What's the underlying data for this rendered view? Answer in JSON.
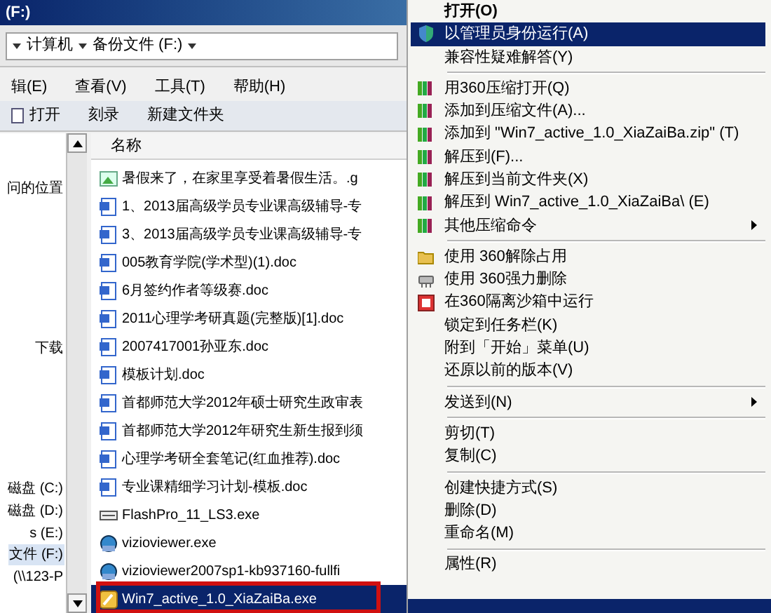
{
  "window": {
    "title": "(F:)"
  },
  "address_bar": {
    "crumbs": [
      "计算机",
      "备份文件 (F:)"
    ]
  },
  "menu_bar": [
    "辑(E)",
    "查看(V)",
    "工具(T)",
    "帮助(H)"
  ],
  "toolbar": [
    "打开",
    "刻录",
    "新建文件夹"
  ],
  "nav_pane": {
    "items": [
      {
        "label": "问的位置",
        "selected": false
      },
      {
        "label": "下载",
        "selected": false
      },
      {
        "label": "磁盘 (C:)",
        "selected": false
      },
      {
        "label": "磁盘 (D:)",
        "selected": false
      },
      {
        "label": "s (E:)",
        "selected": false
      },
      {
        "label": "文件 (F:)",
        "selected": true
      },
      {
        "label": "(\\\\123-P",
        "selected": false
      }
    ]
  },
  "file_list": {
    "columns": [
      "名称"
    ],
    "rows": [
      {
        "name": "暑假来了，在家里享受着暑假生活。.g",
        "kind": "image",
        "selected": false
      },
      {
        "name": "1、2013届高级学员专业课高级辅导-专",
        "kind": "doc",
        "selected": false
      },
      {
        "name": "3、2013届高级学员专业课高级辅导-专",
        "kind": "doc",
        "selected": false
      },
      {
        "name": "005教育学院(学术型)(1).doc",
        "kind": "doc",
        "selected": false
      },
      {
        "name": "6月签约作者等级赛.doc",
        "kind": "doc",
        "selected": false
      },
      {
        "name": "2011心理学考研真题(完整版)[1].doc",
        "kind": "doc",
        "selected": false
      },
      {
        "name": "2007417001孙亚东.doc",
        "kind": "doc",
        "selected": false
      },
      {
        "name": "模板计划.doc",
        "kind": "doc",
        "selected": false
      },
      {
        "name": "首都师范大学2012年硕士研究生政审表",
        "kind": "doc",
        "selected": false
      },
      {
        "name": "首都师范大学2012年研究生新生报到须",
        "kind": "doc",
        "selected": false
      },
      {
        "name": "心理学考研全套笔记(红血推荐).doc",
        "kind": "doc",
        "selected": false
      },
      {
        "name": "专业课精细学习计划-模板.doc",
        "kind": "doc",
        "selected": false
      },
      {
        "name": "FlashPro_11_LS3.exe",
        "kind": "exe",
        "selected": false
      },
      {
        "name": "vizioviewer.exe",
        "kind": "setup",
        "selected": false
      },
      {
        "name": "vizioviewer2007sp1-kb937160-fullfi",
        "kind": "setup",
        "selected": false
      },
      {
        "name": "Win7_active_1.0_XiaZaiBa.exe",
        "kind": "app",
        "selected": true
      }
    ]
  },
  "context_menu": {
    "items": [
      {
        "kind": "item",
        "label": "打开(O)",
        "bold": true,
        "selected": false
      },
      {
        "kind": "item",
        "label": "以管理员身份运行(A)",
        "selected": true
      },
      {
        "kind": "item",
        "label": "兼容性疑难解答(Y)",
        "selected": false
      },
      {
        "kind": "separator"
      },
      {
        "kind": "item",
        "label": "用360压缩打开(Q)",
        "selected": false
      },
      {
        "kind": "item",
        "label": "添加到压缩文件(A)...",
        "selected": false
      },
      {
        "kind": "item",
        "label": "添加到 \"Win7_active_1.0_XiaZaiBa.zip\" (T)",
        "selected": false
      },
      {
        "kind": "item",
        "label": "解压到(F)...",
        "selected": false
      },
      {
        "kind": "item",
        "label": "解压到当前文件夹(X)",
        "selected": false
      },
      {
        "kind": "item",
        "label": "解压到 Win7_active_1.0_XiaZaiBa\\ (E)",
        "selected": false
      },
      {
        "kind": "item",
        "label": "其他压缩命令",
        "submenu": true,
        "selected": false
      },
      {
        "kind": "separator"
      },
      {
        "kind": "item",
        "label": "使用 360解除占用",
        "selected": false
      },
      {
        "kind": "item",
        "label": "使用 360强力删除",
        "selected": false
      },
      {
        "kind": "item",
        "label": "在360隔离沙箱中运行",
        "selected": false
      },
      {
        "kind": "item",
        "label": "锁定到任务栏(K)",
        "selected": false
      },
      {
        "kind": "item",
        "label": "附到「开始」菜单(U)",
        "selected": false
      },
      {
        "kind": "item",
        "label": "还原以前的版本(V)",
        "selected": false
      },
      {
        "kind": "separator"
      },
      {
        "kind": "item",
        "label": "发送到(N)",
        "submenu": true,
        "selected": false
      },
      {
        "kind": "separator"
      },
      {
        "kind": "item",
        "label": "剪切(T)",
        "selected": false
      },
      {
        "kind": "item",
        "label": "复制(C)",
        "selected": false
      },
      {
        "kind": "separator"
      },
      {
        "kind": "item",
        "label": "创建快捷方式(S)",
        "selected": false
      },
      {
        "kind": "item",
        "label": "删除(D)",
        "selected": false
      },
      {
        "kind": "item",
        "label": "重命名(M)",
        "selected": false
      },
      {
        "kind": "separator"
      },
      {
        "kind": "item",
        "label": "属性(R)",
        "selected": false
      }
    ]
  }
}
